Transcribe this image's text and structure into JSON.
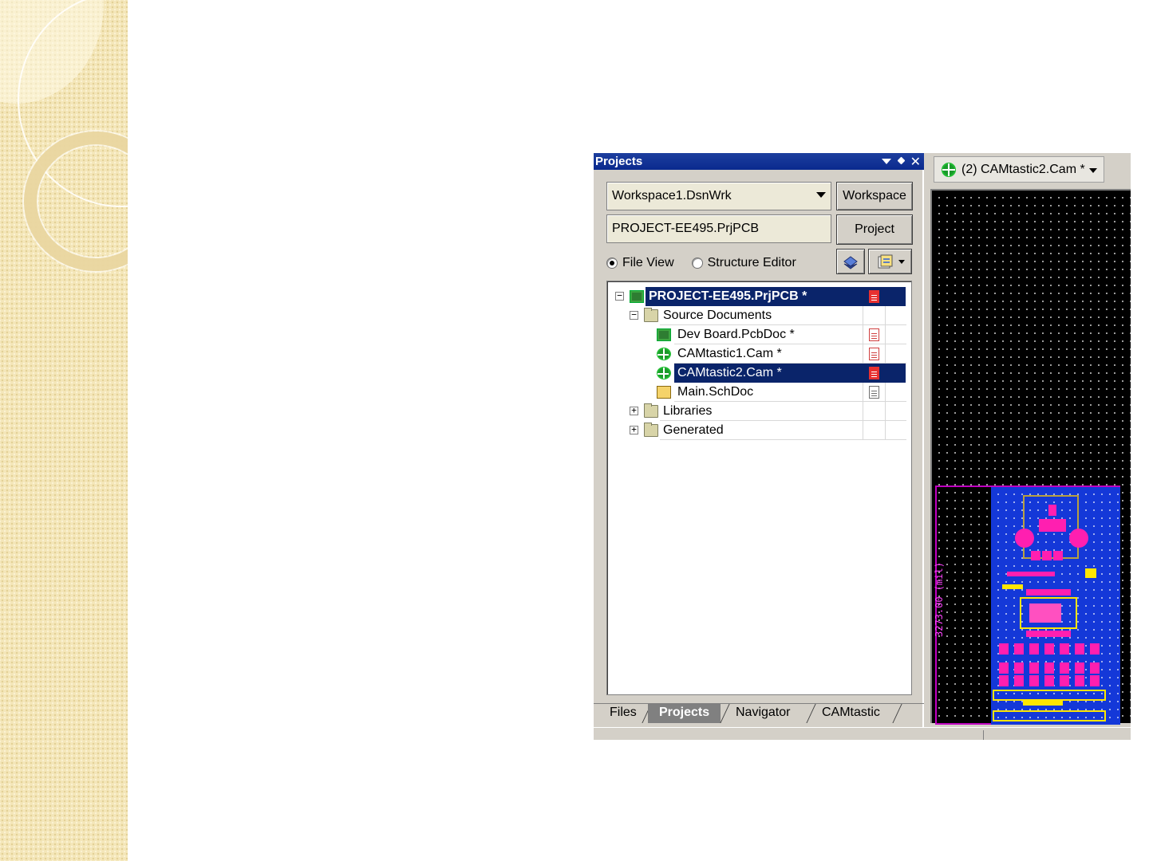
{
  "panel": {
    "title": "Projects",
    "workspace_combo": "Workspace1.DsnWrk",
    "workspace_button": "Workspace",
    "project_field": "PROJECT-EE495.PrjPCB",
    "project_button": "Project",
    "view_options": {
      "file_view": "File View",
      "structure_editor": "Structure Editor",
      "selected": "File View"
    }
  },
  "tree": {
    "project": "PROJECT-EE495.PrjPCB *",
    "source_documents": "Source Documents",
    "documents": [
      {
        "name": "Dev Board.PcbDoc *",
        "icon": "pcb-icon"
      },
      {
        "name": "CAMtastic1.Cam *",
        "icon": "cam-icon"
      },
      {
        "name": "CAMtastic2.Cam *",
        "icon": "cam-icon"
      },
      {
        "name": "Main.SchDoc",
        "icon": "schematic-icon"
      }
    ],
    "libraries": "Libraries",
    "generated": "Generated"
  },
  "tabs": [
    "Files",
    "Projects",
    "Navigator",
    "CAMtastic"
  ],
  "active_tab": "Projects",
  "editor": {
    "doc_tab": "(2) CAMtastic2.Cam *",
    "dimension_label": "3273.00 (mil)"
  },
  "colors": {
    "title_bar": "#0a2a8e",
    "selection": "#0a246a",
    "board_fill": "#1438d8",
    "pad": "#ff1fb0",
    "outline": "#c000c0"
  }
}
